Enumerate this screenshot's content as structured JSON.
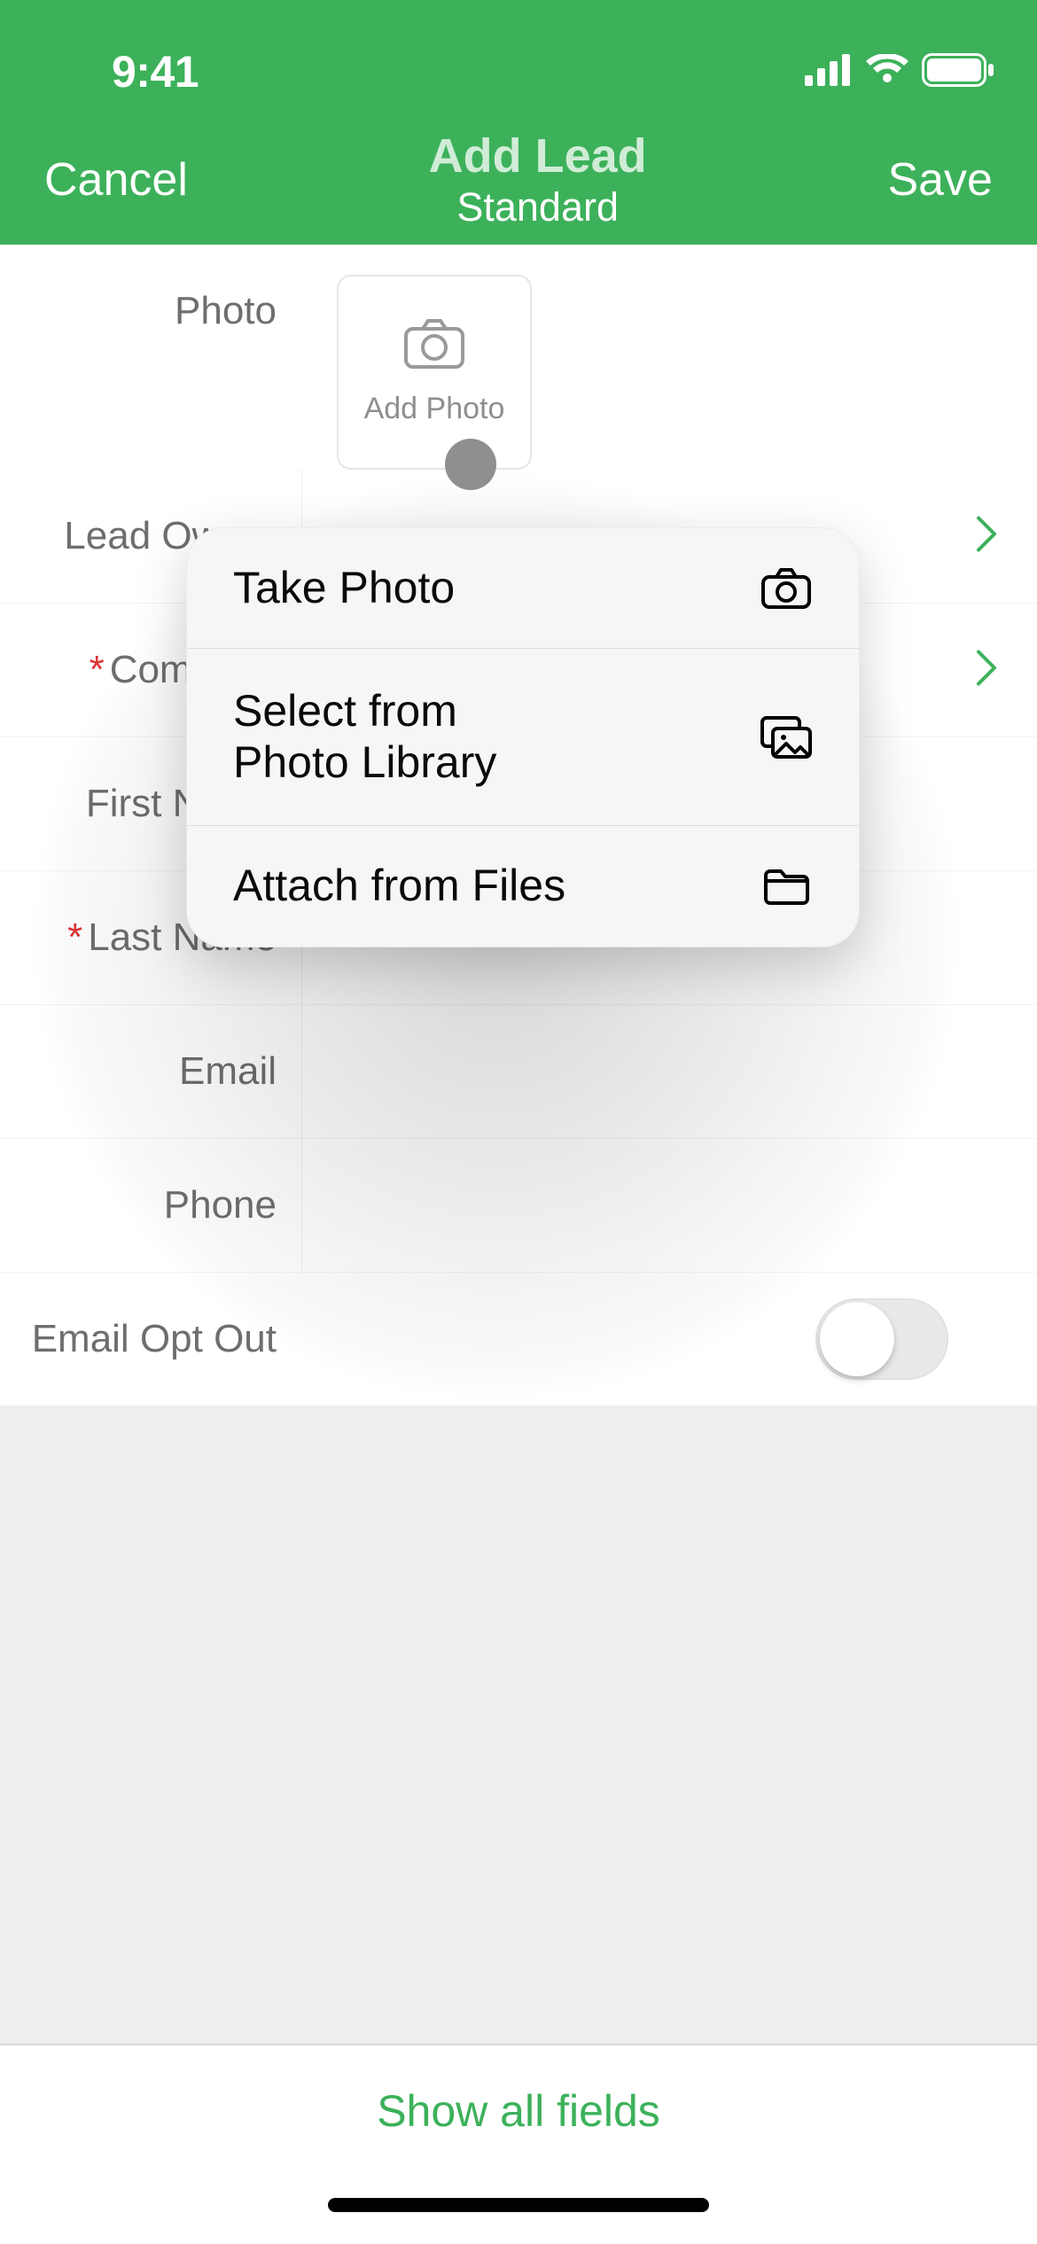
{
  "status": {
    "time": "9:41"
  },
  "nav": {
    "cancel": "Cancel",
    "save": "Save",
    "title": "Add Lead",
    "subtitle": "Standard"
  },
  "photo": {
    "label": "Photo",
    "add_label": "Add Photo"
  },
  "fields": {
    "lead_owner": {
      "label": "Lead Owner",
      "has_chevron": true
    },
    "company": {
      "label": "Company",
      "required": true,
      "has_chevron": true
    },
    "first_name": {
      "label": "First Name"
    },
    "last_name": {
      "label": "Last Name",
      "required": true
    },
    "email": {
      "label": "Email"
    },
    "phone": {
      "label": "Phone"
    },
    "email_opt_out": {
      "label": "Email Opt Out",
      "value": false
    }
  },
  "footer": {
    "show_all": "Show all fields"
  },
  "popover": {
    "take_photo": "Take Photo",
    "select_library": "Select from\nPhoto Library",
    "attach_files": "Attach from Files"
  }
}
